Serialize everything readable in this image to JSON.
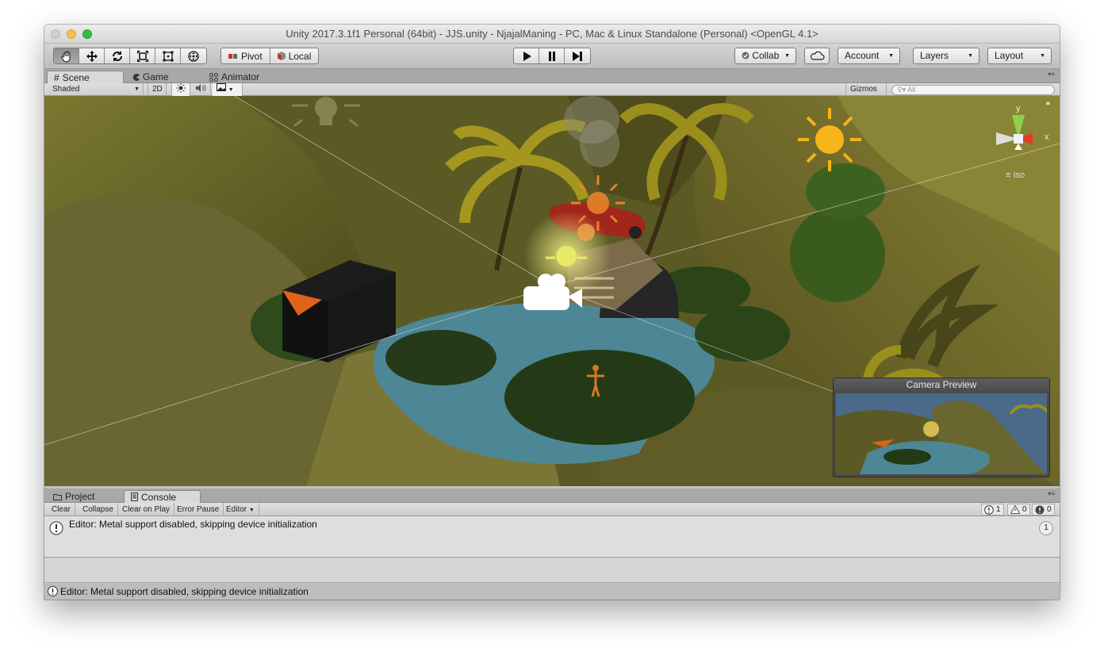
{
  "window": {
    "title": "Unity 2017.3.1f1 Personal (64bit) - JJS.unity - NjajalManing - PC, Mac & Linux Standalone (Personal) <OpenGL 4.1>"
  },
  "toolbar": {
    "tools": [
      "hand-tool",
      "move-tool",
      "rotate-tool",
      "scale-tool",
      "rect-tool",
      "transform-tool"
    ],
    "pivot_label": "Pivot",
    "local_label": "Local",
    "collab_label": "Collab",
    "account_label": "Account",
    "layers_label": "Layers",
    "layout_label": "Layout"
  },
  "top_tabs": [
    {
      "label": "Scene",
      "icon": "grid-icon",
      "active": true
    },
    {
      "label": "Game",
      "icon": "pacman-icon",
      "active": false
    },
    {
      "label": "Animator",
      "icon": "nodes-icon",
      "active": false
    }
  ],
  "scene_toolbar": {
    "shading_mode": "Shaded",
    "mode_2d": "2D",
    "gizmos_label": "Gizmos",
    "search_placeholder": "All"
  },
  "scene": {
    "axis_y": "y",
    "axis_x": "x",
    "projection": "Iso",
    "camera_preview_title": "Camera Preview"
  },
  "bottom_tabs": [
    {
      "label": "Project",
      "icon": "folder-icon",
      "active": false
    },
    {
      "label": "Console",
      "icon": "console-icon",
      "active": true
    }
  ],
  "console": {
    "buttons": [
      "Clear",
      "Collapse",
      "Clear on Play",
      "Error Pause"
    ],
    "editor_dropdown": "Editor",
    "info_count": "1",
    "warning_count": "0",
    "error_count": "0",
    "entries": [
      {
        "message": "Editor: Metal support disabled, skipping device initialization",
        "count": "1"
      }
    ]
  },
  "status_bar": {
    "message": "Editor: Metal support disabled, skipping device initialization"
  },
  "colors": {
    "accent_sun": "#f5b417",
    "water": "#4d8795",
    "terrain": "#6c6a2a"
  }
}
